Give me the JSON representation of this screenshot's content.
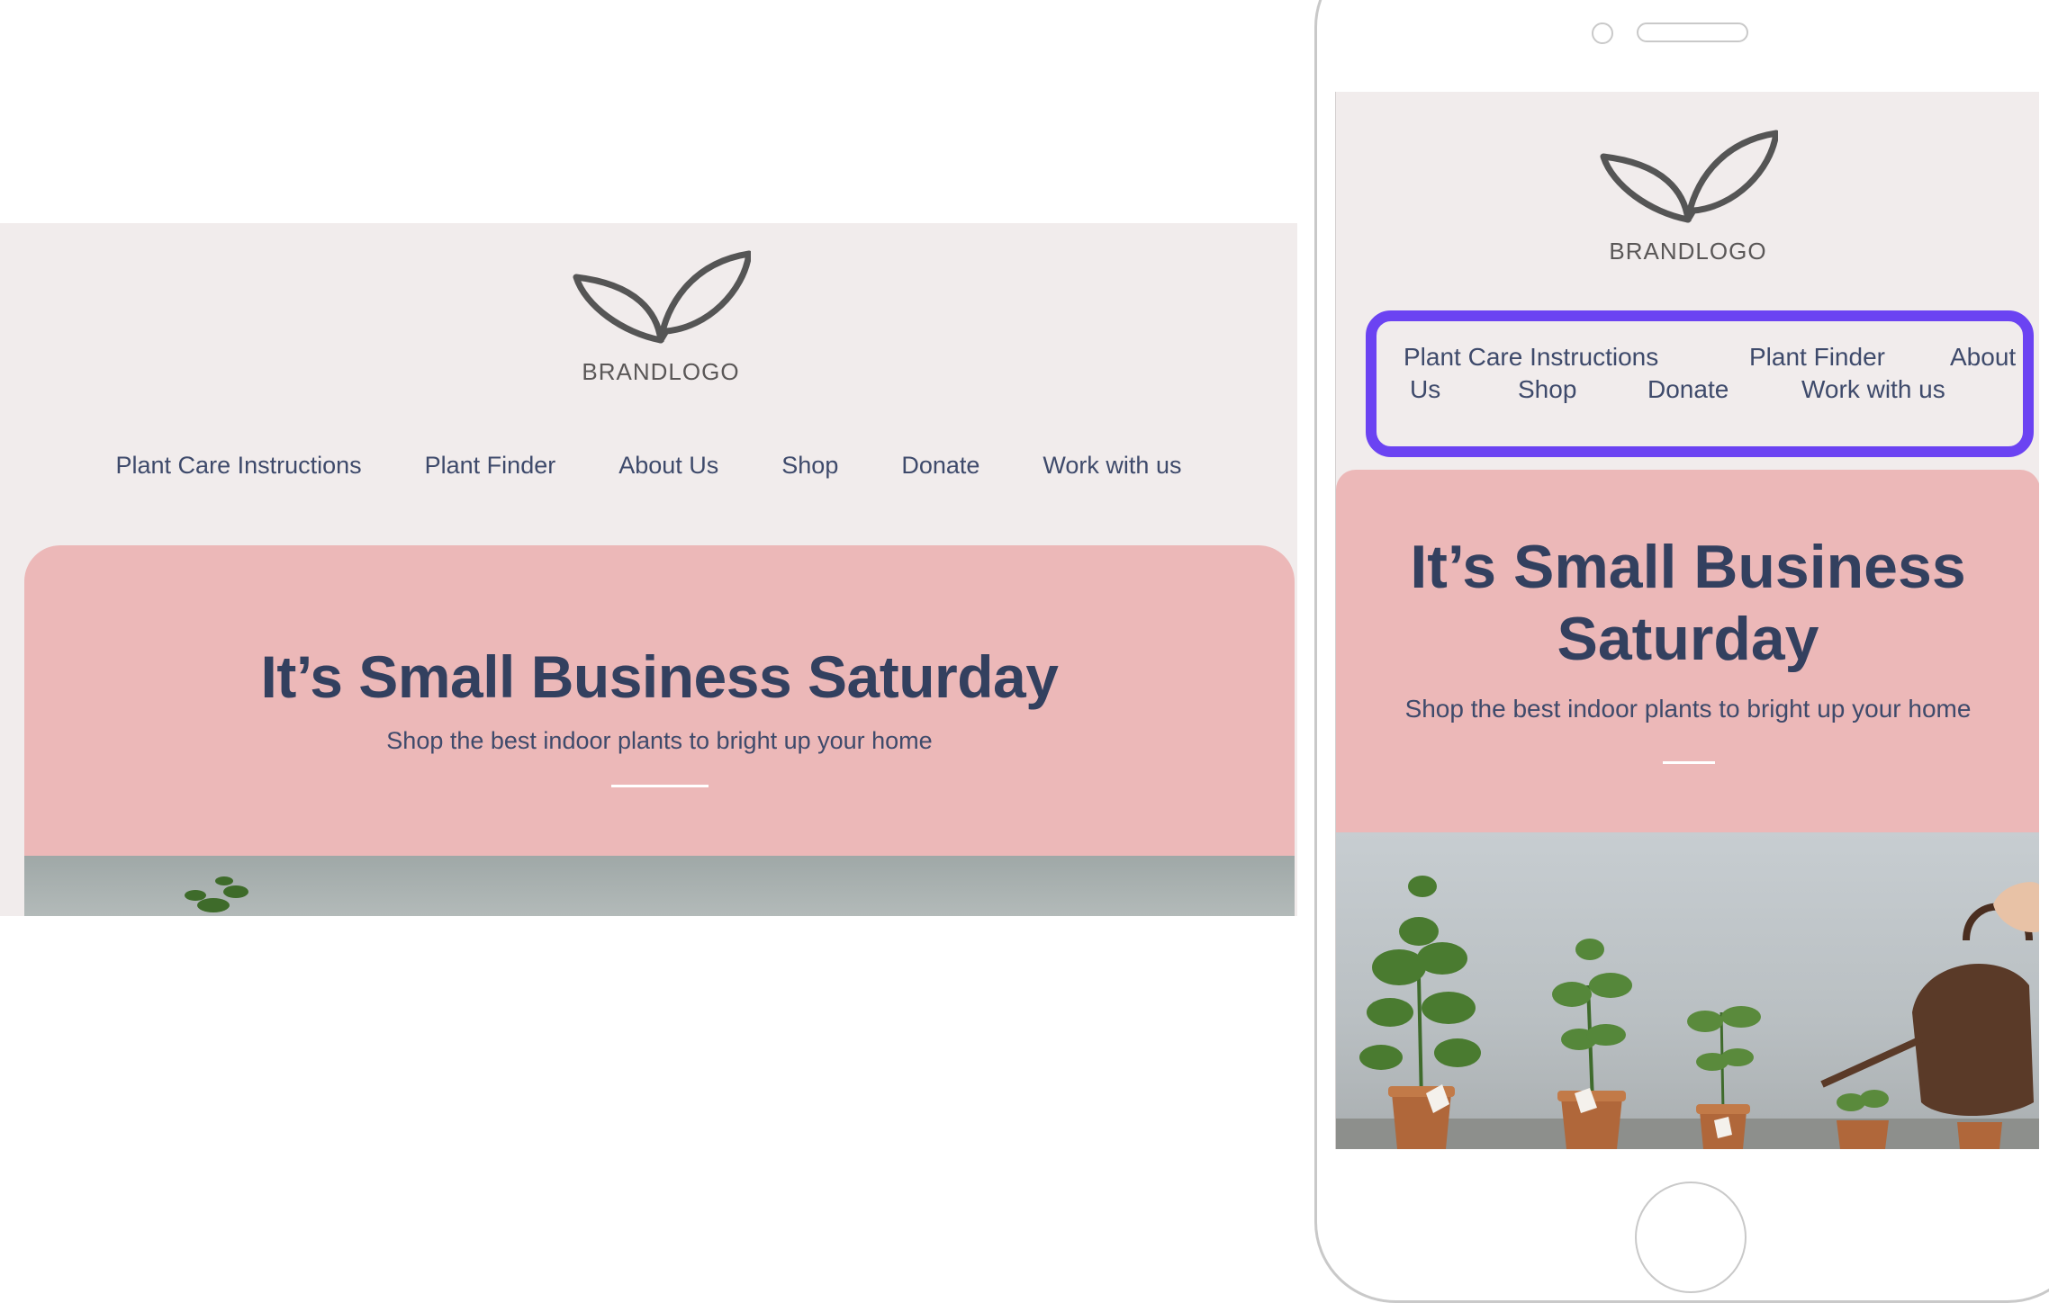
{
  "brand": {
    "logo_text": "BRANDLOGO"
  },
  "nav": {
    "items": [
      "Plant Care Instructions",
      "Plant Finder",
      "About Us",
      "Shop",
      "Donate",
      "Work with us"
    ]
  },
  "mobile_nav": {
    "row1": [
      "Plant Care Instructions",
      "Plant Finder",
      "About"
    ],
    "row2": [
      "Us",
      "Shop",
      "Donate",
      "Work with us"
    ]
  },
  "hero": {
    "title": "It’s Small Business Saturday",
    "title_line1": "It’s Small Business",
    "title_line2": "Saturday",
    "subtitle": "Shop the best indoor plants to bright up your home"
  },
  "colors": {
    "accent_highlight": "#6b43f2",
    "hero_bg": "#ecb8b8",
    "page_bg": "#f1ecec",
    "nav_text": "#3e4a6b",
    "title_text": "#33405f"
  },
  "icons": [
    "leaf-logo-icon",
    "plants-photo"
  ]
}
